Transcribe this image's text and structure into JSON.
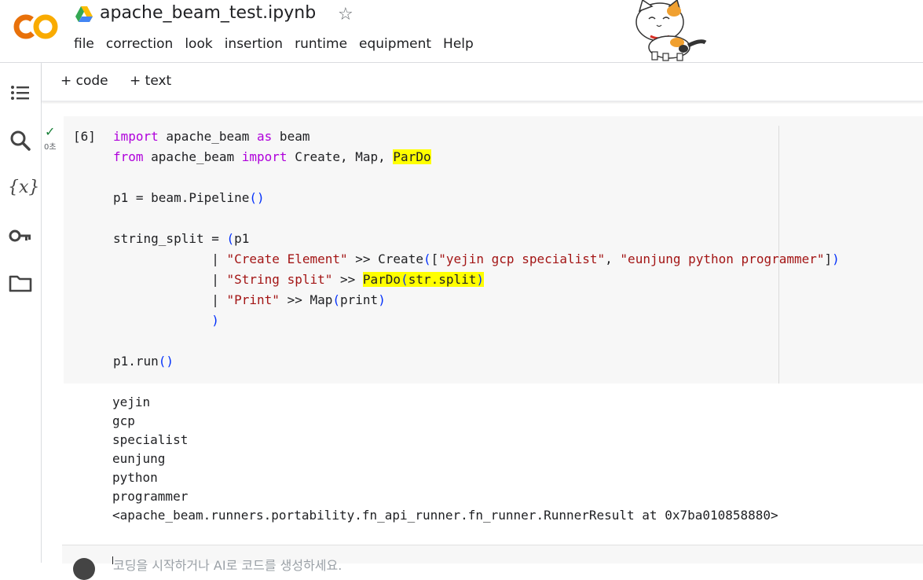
{
  "header": {
    "title": "apache_beam_test.ipynb",
    "logo_text": "CO",
    "menu": [
      "file",
      "correction",
      "look",
      "insertion",
      "runtime",
      "equipment",
      "Help"
    ]
  },
  "toolbar": {
    "add_code": "+ code",
    "add_text": "+ text"
  },
  "sidebar": {
    "icons": [
      "table-of-contents-icon",
      "search-icon",
      "variables-icon",
      "key-icon",
      "folder-icon"
    ],
    "variables_glyph": "{x}"
  },
  "cell": {
    "execution_count": "[6]",
    "status_mark": "✓",
    "elapsed": "0초",
    "code_lines": [
      "import apache_beam as beam",
      "from apache_beam import Create, Map, ParDo",
      "",
      "p1 = beam.Pipeline()",
      "",
      "string_split = (p1",
      "             | \"Create Element\" >> Create([\"yejin gcp specialist\", \"eunjung python programmer\"])",
      "             | \"String split\" >> ParDo(str.split)",
      "             | \"Print\" >> Map(print)",
      "             )",
      "",
      "p1.run()"
    ],
    "highlighted": [
      "ParDo",
      "ParDo(str.split)"
    ]
  },
  "output": {
    "lines": [
      "yejin",
      "gcp",
      "specialist",
      "eunjung",
      "python",
      "programmer",
      "<apache_beam.runners.portability.fn_api_runner.fn_runner.RunnerResult at 0x7ba010858880>"
    ]
  },
  "new_cell": {
    "placeholder": "코딩을 시작하거나 AI로 코드를 생성하세요."
  },
  "colors": {
    "keyword": "#af00db",
    "string": "#a31515",
    "bracket": "#0431fa",
    "highlight": "#ffff00",
    "logo_orange": "#f9ab00",
    "logo_dark_orange": "#e8710a"
  }
}
